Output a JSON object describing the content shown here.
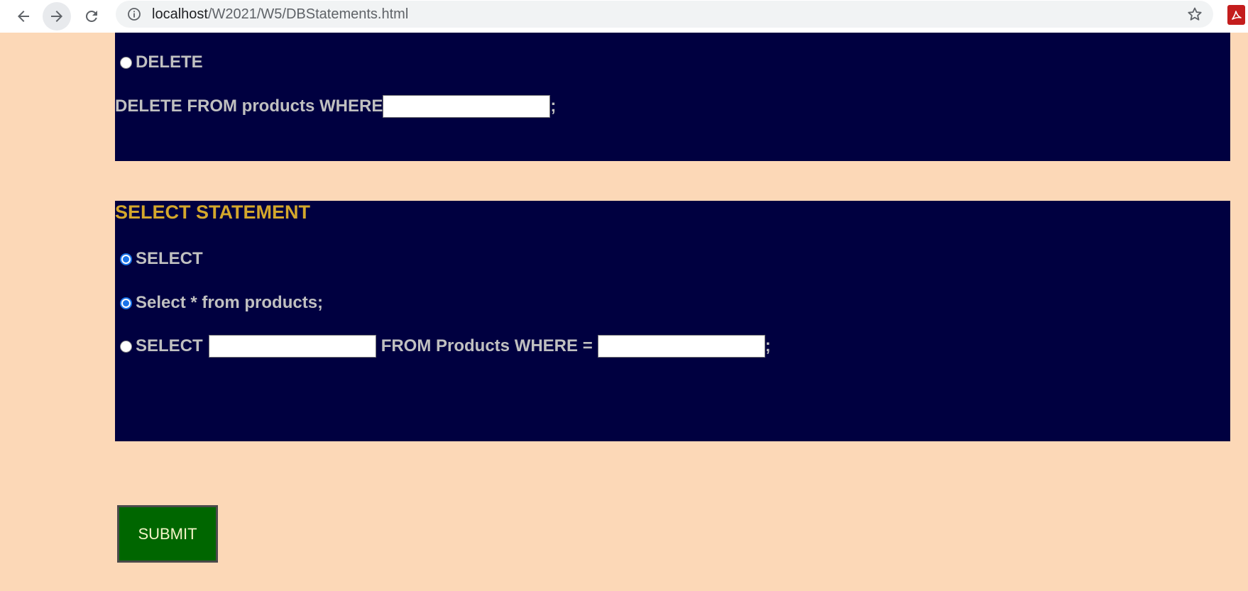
{
  "browser": {
    "url_host": "localhost",
    "url_path": "/W2021/W5/DBStatements.html"
  },
  "delete_section": {
    "option_label": "DELETE",
    "statement_prefix": "DELETE FROM products WHERE",
    "statement_suffix": ";",
    "where_value": "",
    "option_checked": false
  },
  "select_section": {
    "title": "SELECT STATEMENT",
    "option_select_label": "SELECT",
    "option_all_label": "Select * from products;",
    "option_custom_prefix": "SELECT",
    "option_custom_middle": "FROM Products WHERE =",
    "option_custom_suffix": ";",
    "columns_value": "",
    "where_value": "",
    "option_select_checked": true,
    "option_all_checked": true,
    "option_custom_checked": false
  },
  "submit_label": "SUBMIT",
  "colors": {
    "page_background": "#fcd8b7",
    "panel_background": "#000040",
    "panel_text": "#c0c0c0",
    "section_title": "#d4a72c",
    "submit_background": "#006600",
    "radio_accent": "#1a73e8"
  },
  "icons": {
    "back": "arrow-left",
    "forward": "arrow-right",
    "reload": "refresh",
    "site_info": "info-circle",
    "bookmark": "star-outline",
    "extension": "acrobat-pdf"
  }
}
